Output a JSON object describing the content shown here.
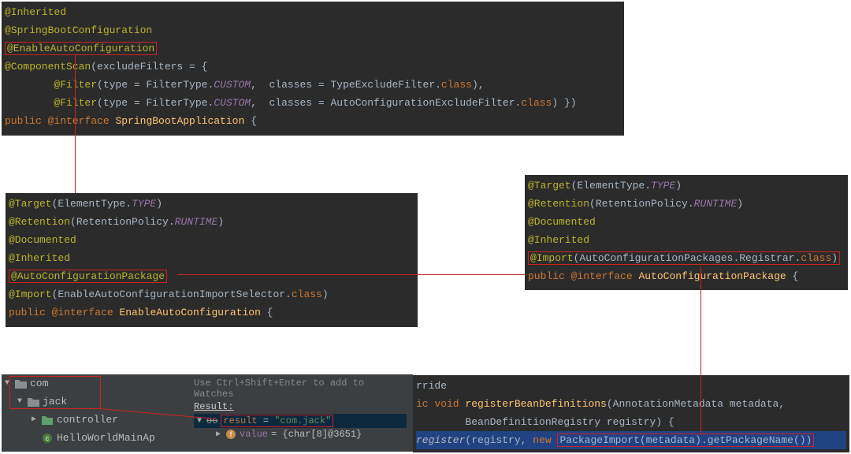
{
  "box_sba": {
    "l1_ann": "@Inherited",
    "l2_ann": "@SpringBootConfiguration",
    "l3_ann": "@EnableAutoConfiguration",
    "l4_ann": "@ComponentScan",
    "l4_rest_a": "(excludeFilters = {",
    "l5_ann": "@Filter",
    "l5_b": "(type = FilterType.",
    "l5_c": "CUSTOM",
    "l5_d": ",  classes = TypeExcludeFilter.",
    "l5_e": "class",
    "l5_f": "),",
    "l6_ann": "@Filter",
    "l6_b": "(type = FilterType.",
    "l6_c": "CUSTOM",
    "l6_d": ",  classes = AutoConfigurationExcludeFilter.",
    "l6_e": "class",
    "l6_f": ") })",
    "l7_a": "public ",
    "l7_b": "@interface ",
    "l7_c": "SpringBootApplication",
    "l7_d": " {"
  },
  "box_eac": {
    "l1_ann": "@Target",
    "l1_b": "(ElementType.",
    "l1_c": "TYPE",
    "l1_d": ")",
    "l2_ann": "@Retention",
    "l2_b": "(RetentionPolicy.",
    "l2_c": "RUNTIME",
    "l2_d": ")",
    "l3_ann": "@Documented",
    "l4_ann": "@Inherited",
    "l5_ann": "@AutoConfigurationPackage",
    "l6_ann": "@Import",
    "l6_b": "(EnableAutoConfigurationImportSelector.",
    "l6_c": "class",
    "l6_d": ")",
    "l7_a": "public ",
    "l7_b": "@interface ",
    "l7_c": "EnableAutoConfiguration",
    "l7_d": " {"
  },
  "box_acp": {
    "l1_ann": "@Target",
    "l1_b": "(ElementType.",
    "l1_c": "TYPE",
    "l1_d": ")",
    "l2_ann": "@Retention",
    "l2_b": "(RetentionPolicy.",
    "l2_c": "RUNTIME",
    "l2_d": ")",
    "l3_ann": "@Documented",
    "l4_ann": "@Inherited",
    "l5_ann": "@Import",
    "l5_b": "(AutoConfigurationPackages.Registrar.",
    "l5_c": "class",
    "l5_d": ")",
    "l6_a": "public ",
    "l6_b": "@interface ",
    "l6_c": "AutoConfigurationPackage",
    "l6_d": " {"
  },
  "box_reg": {
    "l0_a": "rride",
    "l1_a": "ic ",
    "l1_b": "void ",
    "l1_c": "registerBeanDefinitions",
    "l1_d": "(AnnotationMetadata metadata,",
    "l2_a": "BeanDefinitionRegistry registry) {",
    "l3_a": "register",
    "l3_b": "(registry, ",
    "l3_c": "new ",
    "l3_d": "PackageImport",
    "l3_e": "(metadata).",
    "l3_f": "getPackageName",
    "l3_g": "())"
  },
  "tree": {
    "n1": "com",
    "n2": "jack",
    "n3": "controller",
    "n4": "HelloWorldMainAp"
  },
  "watches": {
    "hint": "Use Ctrl+Shift+Enter to add to Watches",
    "result_label": "Result:",
    "oo": "oo",
    "result_a": "result",
    "result_eq": " = ",
    "result_val": "\"com.jack\"",
    "value_a": "value",
    "value_b": " = {char[8]@3651}"
  },
  "watermark": ""
}
